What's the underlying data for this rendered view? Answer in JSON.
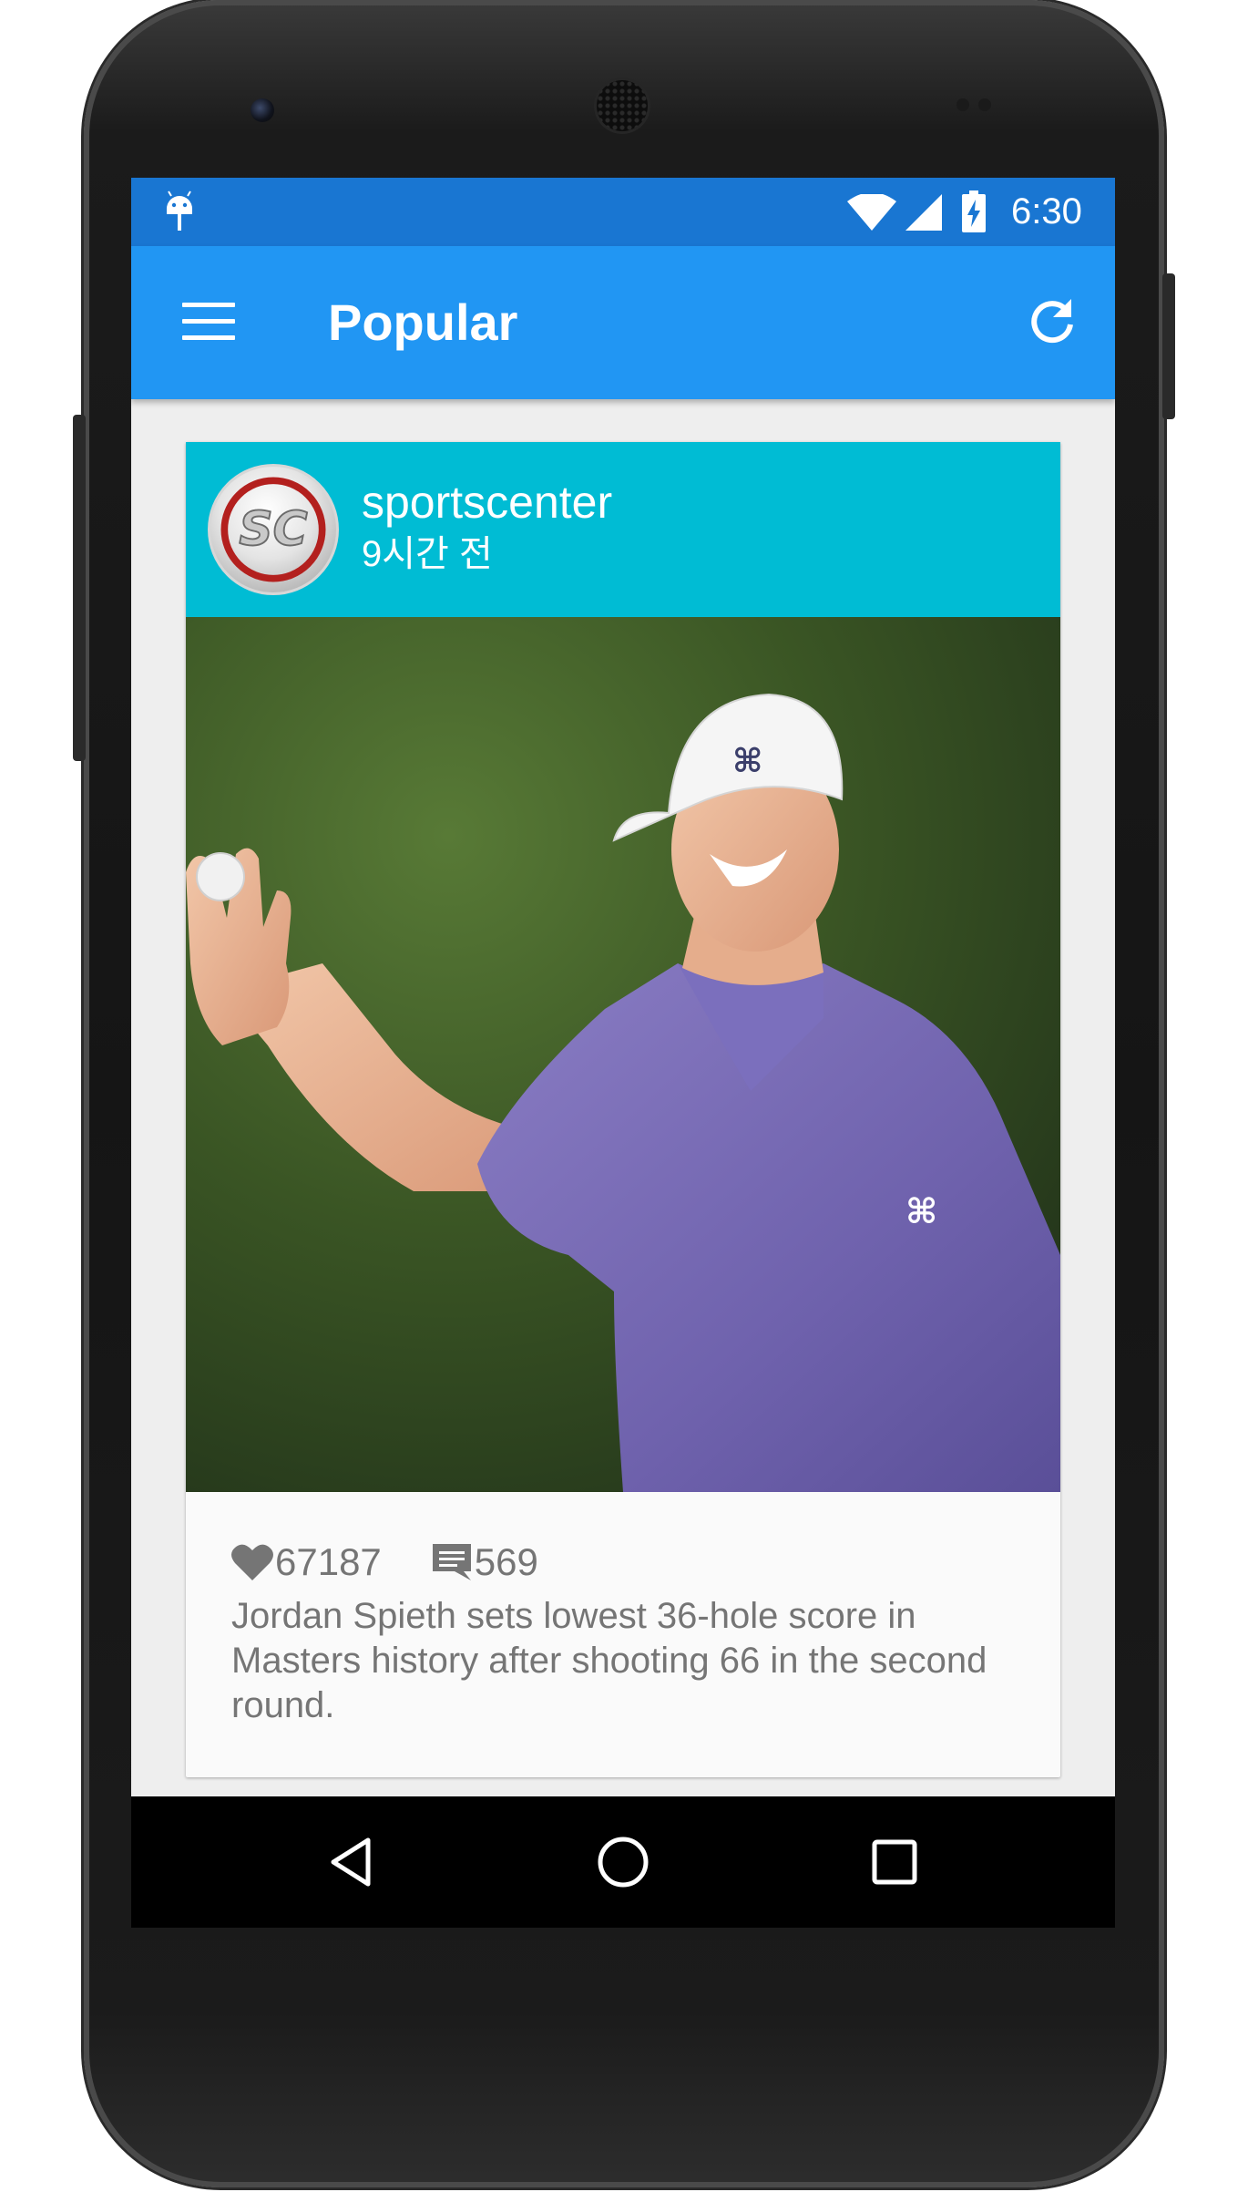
{
  "status_bar": {
    "time": "6:30",
    "icons": [
      "android-icon",
      "wifi-icon",
      "signal-icon",
      "battery-charging-icon"
    ]
  },
  "app_bar": {
    "title": "Popular",
    "left_icon": "menu-icon",
    "right_icon": "refresh-icon"
  },
  "post": {
    "username": "sportscenter",
    "time_ago": "9시간 전",
    "avatar_text": "SC",
    "likes": "67187",
    "comments": "569",
    "caption": "Jordan Spieth sets lowest 36-hole score in Masters history after shooting 66 in the second round."
  },
  "nav_bar": {
    "icons": [
      "back-icon",
      "home-icon",
      "recents-icon"
    ]
  },
  "colors": {
    "status_bar": "#1976d2",
    "app_bar": "#2196f3",
    "card_header": "#00bcd4",
    "screen_bg": "#eeeeee",
    "card_bg": "#fafafa",
    "text_secondary": "#757575"
  }
}
